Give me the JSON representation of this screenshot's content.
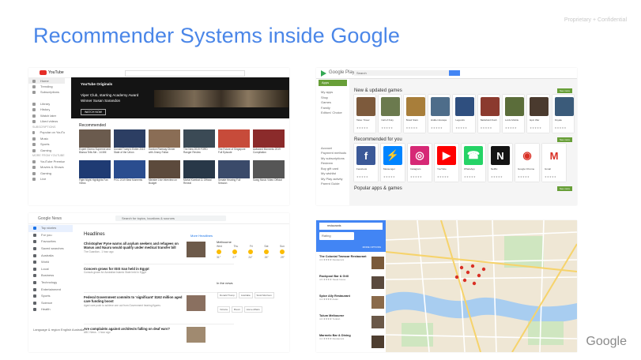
{
  "slide": {
    "title": "Recommender Systems inside Google",
    "confidential": "Proprietary + Confidential",
    "logo": "Google"
  },
  "youtube": {
    "wordmark": "YouTube",
    "sidebar": [
      "Home",
      "Trending",
      "Subscriptions",
      "Library",
      "History",
      "Watch later",
      "Liked videos"
    ],
    "subs_header": "SUBSCRIPTIONS",
    "subs": [
      "Popular on YouTube",
      "Music",
      "Sports",
      "Gaming"
    ],
    "more_header": "MORE FROM YOUTUBE",
    "more": [
      "YouTube Premium",
      "Movies & Shows",
      "Gaming",
      "Live"
    ],
    "banner": {
      "brand": "YouTube Originals",
      "line1": "Viper Club, starring Academy Award",
      "line2": "Winner Susan Sarandon",
      "button": "WATCH NOW"
    },
    "recommended": "Recommended",
    "videos": [
      {
        "title": "Expert Giorno Supreme and Blanca Tells Me - 14 Mill",
        "color": "#6b5b4e"
      },
      {
        "title": "Donald Trump's Entire 2019 State of the Union",
        "color": "#2c3e63"
      },
      {
        "title": "Gordon Ramsay Dinner with Jimmy Fallon",
        "color": "#8a6d55"
      },
      {
        "title": "The New 2019 FORD Ranger Review",
        "color": "#3b4a55"
      },
      {
        "title": "The Future of Singapore Full Episode",
        "color": "#c74b3a"
      },
      {
        "title": "Awkward Moments 2019 Compilation",
        "color": "#8b2b2b"
      },
      {
        "title": "Fight Night Highlights Fan Views",
        "color": "#1f3b73"
      },
      {
        "title": "PGC 2019 Best Moments",
        "color": "#2a4d8f"
      },
      {
        "title": "Minister Live Interview on Budget",
        "color": "#5c4a3c"
      },
      {
        "title": "Mortal Kombat 11 Official Reveal",
        "color": "#283848"
      },
      {
        "title": "Senate Hearing Full Session",
        "color": "#3a4a6a"
      },
      {
        "title": "Swag Music Video Official",
        "color": "#565656"
      }
    ]
  },
  "play": {
    "wordmark": "Google Play",
    "search_placeholder": "Search",
    "apps_tab": "Apps",
    "sidebar": [
      "My apps",
      "Shop",
      "Games",
      "Family",
      "Editors' Choice",
      "Account",
      "Payment methods",
      "My subscriptions",
      "Redeem",
      "Buy gift card",
      "My wishlist",
      "My Play activity",
      "Parent Guide"
    ],
    "new_games": "New & updated games",
    "recommended": "Recommended for you",
    "popular": "Popular apps & games",
    "more_label": "See more",
    "games": [
      {
        "name": "Tales: Tower",
        "color": "#7d5a3c"
      },
      {
        "name": "Call of Duty",
        "color": "#6b7a4e"
      },
      {
        "name": "Brawl Stars",
        "color": "#a87e3a"
      },
      {
        "name": "Hidden Escape",
        "color": "#4e6d8a"
      },
      {
        "name": "Legends",
        "color": "#2f4f7f"
      },
      {
        "name": "Battlefield Rush",
        "color": "#8b3a2e"
      },
      {
        "name": "Lords Mobile",
        "color": "#5b6d3a"
      },
      {
        "name": "Epic War",
        "color": "#4a3a2e"
      },
      {
        "name": "Royale",
        "color": "#3b5b7a"
      }
    ],
    "apps": [
      {
        "name": "Facebook",
        "color": "#3b5998",
        "glyph": "f"
      },
      {
        "name": "Messenger",
        "color": "#0084ff",
        "glyph": "⚡"
      },
      {
        "name": "Instagram",
        "color": "#d62976",
        "glyph": "◎"
      },
      {
        "name": "YouTube",
        "color": "#ff0000",
        "glyph": "▶"
      },
      {
        "name": "WhatsApp",
        "color": "#25d366",
        "glyph": "☎"
      },
      {
        "name": "Netflix",
        "color": "#141414",
        "glyph": "N"
      },
      {
        "name": "Google Chrome",
        "color": "#ffffff",
        "glyph": "◉"
      },
      {
        "name": "Gmail",
        "color": "#ffffff",
        "glyph": "M"
      }
    ]
  },
  "news": {
    "wordmark": "Google News",
    "search_placeholder": "Search for topics, locations & sources",
    "sidebar": [
      "Top stories",
      "For you",
      "Favourites",
      "Saved searches",
      "Australia",
      "World",
      "Local",
      "Business",
      "Technology",
      "Entertainment",
      "Sports",
      "Science",
      "Health"
    ],
    "lang": "Language & region English Australia",
    "headlines": "Headlines",
    "more_headlines": "More Headlines",
    "stories": [
      {
        "headline": "Christopher Pyne warns all asylum seekers and refugees on Manus and Nauru would qualify under medical transfer bill",
        "source": "The Guardian - 1 hour ago"
      },
      {
        "headline": "Concern grows for ISIS Iran held in Egypt",
        "source": "Consuls grows for Australian Islamic State held in Egypt"
      },
      {
        "headline": "Federal Government commits to 'significant' $162 million aged care funding boost",
        "source": "Aged care push to achieve one out from Government hearing figures"
      },
      {
        "headline": "Are complaints against architects falling on deaf ears?",
        "source": "ABC News - 1 hour ago"
      }
    ],
    "weather": {
      "city": "Melbourne",
      "days": [
        "Wed",
        "Thu",
        "Fri",
        "Sat",
        "Sun"
      ],
      "temps": [
        "31°",
        "27°",
        "24°",
        "26°",
        "29°"
      ]
    },
    "in_news": "In the news",
    "topics": [
      "Donald Trump",
      "Australia",
      "Scott Morrison",
      "Victoria",
      "Brexit",
      "Home Affairs"
    ]
  },
  "maps": {
    "search_value": "restaurants",
    "filter_label": "Rating",
    "more_label": "MORE OPTIONS",
    "results": [
      {
        "name": "The Colonial Tramcar Restaurant",
        "detail": "4.3 ★★★★ Restaurant"
      },
      {
        "name": "Rockpool Bar & Grill",
        "detail": "4.5 ★★★★ Steak house"
      },
      {
        "name": "Spice Ally Restaurant",
        "detail": "4.4 ★★★★ Asian"
      },
      {
        "name": "Tulum Melbourne",
        "detail": "4.6 ★★★★ Turkish"
      },
      {
        "name": "Marmelo Bar & Dining",
        "detail": "4.2 ★★★★ Restaurant"
      }
    ]
  }
}
